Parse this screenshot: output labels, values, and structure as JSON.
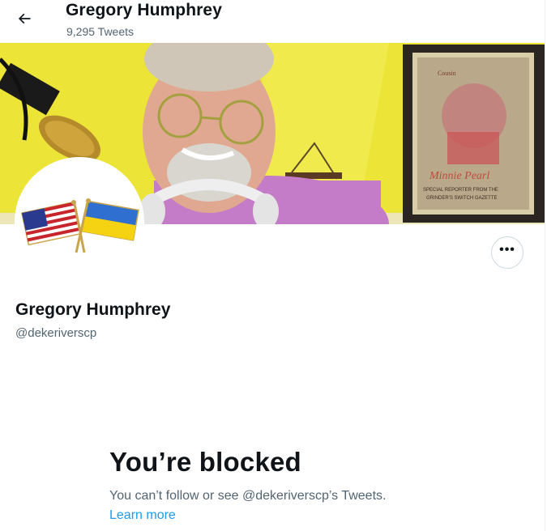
{
  "header": {
    "name": "Gregory Humphrey",
    "tweet_count": "9,295 Tweets"
  },
  "icons": {
    "back": "arrow-left-icon",
    "more": "more-options-icon"
  },
  "poster": {
    "line1": "Cousin",
    "line2": "Minnie Pearl",
    "line3": "SPECIAL REPORTER FROM THE",
    "line4": "GRINDER'S SWITCH GAZETTE"
  },
  "profile": {
    "name": "Gregory Humphrey",
    "handle": "@dekeriverscp",
    "more_label": "•••"
  },
  "blocked": {
    "title": "You’re blocked",
    "description": "You can’t follow or see @dekeriverscp’s Tweets.",
    "learn_more": "Learn more"
  },
  "colors": {
    "link": "#1d9bf0",
    "secondary_text": "#536471",
    "banner_wall": "#efe33a"
  }
}
